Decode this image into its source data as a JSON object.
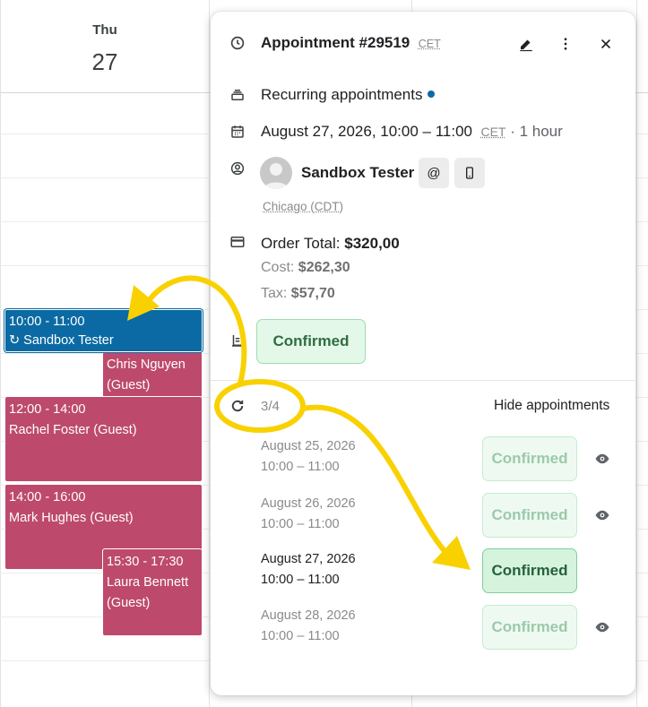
{
  "calendar": {
    "day_name": "Thu",
    "day_number": "27",
    "events": [
      {
        "time": "10:00 - 11:00",
        "title": "↻ Sandbox Tester"
      },
      {
        "title": "Chris Nguyen (Guest)"
      },
      {
        "time": "12:00 - 14:00",
        "title": "Rachel Foster (Guest)"
      },
      {
        "time": "14:00 - 16:00",
        "title": "Mark Hughes (Guest)"
      },
      {
        "time": "15:30 - 17:30",
        "title": "Laura Bennett (Guest)"
      }
    ]
  },
  "popover": {
    "title": "Appointment #29519",
    "title_tz": "CET",
    "recurring_label": "Recurring appointments",
    "datetime": "August 27, 2026, 10:00 – 11:00",
    "datetime_tz": "CET",
    "duration": "· 1 hour",
    "customer_name": "Sandbox Tester",
    "email_icon_glyph": "@",
    "customer_timezone": "Chicago (CDT)",
    "order_total_label": "Order Total:",
    "order_total_value": "$320,00",
    "cost_label": "Cost:",
    "cost_value": "$262,30",
    "tax_label": "Tax:",
    "tax_value": "$57,70",
    "status": "Confirmed",
    "occurrence_counter": "3/4",
    "hide_label": "Hide appointments",
    "occurrences": [
      {
        "date": "August 25, 2026",
        "time": "10:00 – 11:00",
        "status": "Confirmed"
      },
      {
        "date": "August 26, 2026",
        "time": "10:00 – 11:00",
        "status": "Confirmed"
      },
      {
        "date": "August 27, 2026",
        "time": "10:00 – 11:00",
        "status": "Confirmed"
      },
      {
        "date": "August 28, 2026",
        "time": "10:00 – 11:00",
        "status": "Confirmed"
      }
    ]
  },
  "colors": {
    "event_pink": "#bd4a6c",
    "event_blue": "#0b6aa3",
    "confirmed_green": "#2f6d43",
    "annotation_yellow": "#f9d100"
  },
  "icons": {
    "title": "clock-icon",
    "edit": "pencil-icon",
    "more": "more-vertical-icon",
    "close": "close-icon",
    "recurring": "stack-icon",
    "date": "calendar-icon",
    "customer": "user-circle-icon",
    "payment": "credit-card-icon",
    "status": "clipboard-icon",
    "repeat": "refresh-icon",
    "view": "eye-icon"
  }
}
